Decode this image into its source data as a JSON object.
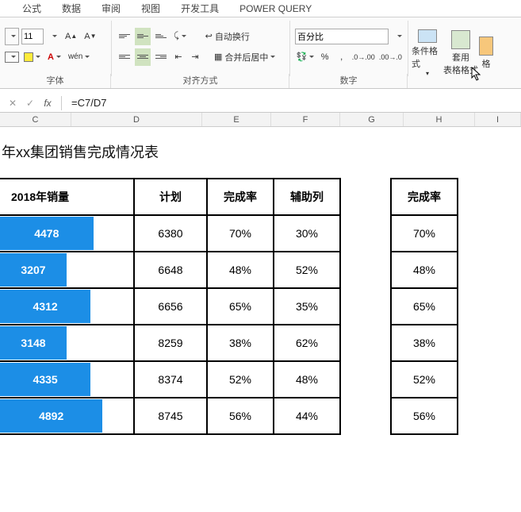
{
  "menu": {
    "items": [
      "公式",
      "数据",
      "审阅",
      "视图",
      "开发工具",
      "POWER QUERY"
    ]
  },
  "ribbon": {
    "font_size": "11",
    "number_format": "百分比",
    "wrap_label": "自动换行",
    "merge_label": "合并后居中",
    "groups": {
      "font": "字体",
      "align": "对齐方式",
      "number": "数字"
    },
    "cond_format": "条件格式",
    "table_format": "套用\n表格格式",
    "format_char": "格"
  },
  "formula_bar": {
    "cancel": "✕",
    "ok": "✓",
    "fx": "fx",
    "formula": "=C7/D7"
  },
  "cols": {
    "C": "C",
    "D": "D",
    "E": "E",
    "F": "F",
    "G": "G",
    "H": "H",
    "I": "I"
  },
  "sheet": {
    "title": "年xx集团销售完成情况表",
    "headers": {
      "sales": "2018年销量",
      "plan": "计划",
      "rate": "完成率",
      "aux": "辅助列",
      "rate2": "完成率"
    }
  },
  "chart_data": {
    "type": "table",
    "title": "年xx集团销售完成情况表",
    "columns": [
      "2018年销量",
      "计划",
      "完成率",
      "辅助列",
      "完成率(H)"
    ],
    "rows": [
      {
        "sales": 4478,
        "plan": 6380,
        "rate": "70%",
        "aux": "30%",
        "rate2": "70%",
        "bar_pct": 70
      },
      {
        "sales": 3207,
        "plan": 6648,
        "rate": "48%",
        "aux": "52%",
        "rate2": "48%",
        "bar_pct": 50
      },
      {
        "sales": 4312,
        "plan": 6656,
        "rate": "65%",
        "aux": "35%",
        "rate2": "65%",
        "bar_pct": 68
      },
      {
        "sales": 3148,
        "plan": 8259,
        "rate": "38%",
        "aux": "62%",
        "rate2": "38%",
        "bar_pct": 50
      },
      {
        "sales": 4335,
        "plan": 8374,
        "rate": "52%",
        "aux": "48%",
        "rate2": "52%",
        "bar_pct": 68
      },
      {
        "sales": 4892,
        "plan": 8745,
        "rate": "56%",
        "aux": "44%",
        "rate2": "56%",
        "bar_pct": 77
      }
    ]
  }
}
